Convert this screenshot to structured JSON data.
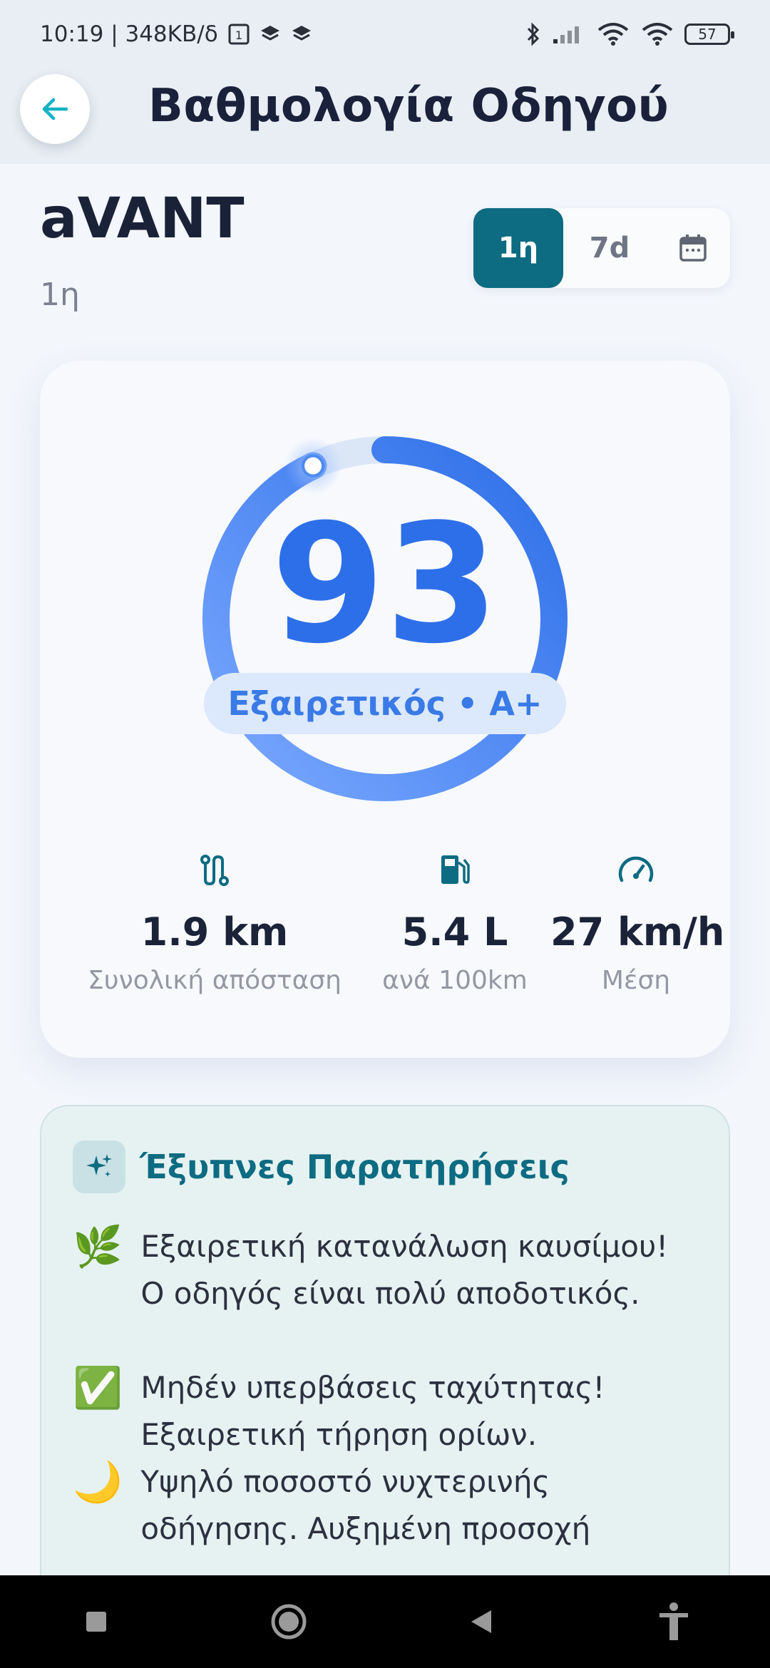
{
  "status_bar": {
    "time_and_speed": "10:19 | 348KB/δ",
    "battery": "57"
  },
  "header": {
    "title": "Βαθμολογία Οδηγού"
  },
  "vehicle": {
    "name": "aVANT",
    "period": "1η"
  },
  "range_toggle": {
    "options": [
      "1η",
      "7d"
    ],
    "selected": "1η"
  },
  "score": {
    "value": "93",
    "progress_percent": 93,
    "grade": "Εξαιρετικός • A+",
    "color": "#2d6fe8"
  },
  "metrics": [
    {
      "icon": "route-icon",
      "value": "1.9 km",
      "label": "Συνολική απόσταση"
    },
    {
      "icon": "fuel-icon",
      "value": "5.4 L",
      "label": "ανά 100km"
    },
    {
      "icon": "speedometer-icon",
      "value": "27 km/h",
      "label": "Μέση"
    }
  ],
  "insights": {
    "title": "Έξυπνες Παρατηρήσεις",
    "items": [
      {
        "emoji": "🌿",
        "text": "Εξαιρετική κατανάλωση καυσίμου! Ο οδηγός είναι πολύ αποδοτικός."
      },
      {
        "emoji": "✅",
        "text": "Μηδέν υπερβάσεις ταχύτητας! Εξαιρετική τήρηση ορίων."
      },
      {
        "emoji": "🌙",
        "text": "Υψηλό ποσοστό νυχτερινής οδήγησης. Αυξημένη προσοχή"
      }
    ]
  },
  "colors": {
    "accent": "#0d6b82",
    "score_blue": "#2d6fe8",
    "insights_bg": "#e6f2f1"
  }
}
